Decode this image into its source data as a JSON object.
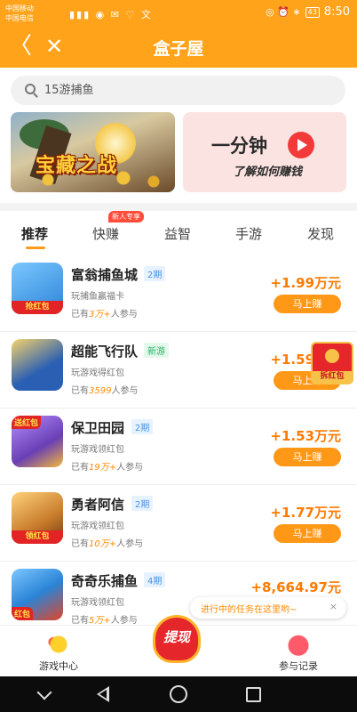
{
  "status_bar": {
    "carrier1": "中国移动",
    "carrier2": "中国电信",
    "icons": "▮▮▮ ◉ ✉ ♡ 文",
    "right_icons": "◎ ⏰ ∗",
    "battery": "43",
    "time": "8:50"
  },
  "nav": {
    "back_icon": "〈",
    "close_icon": "✕",
    "title": "盒子屋"
  },
  "search": {
    "placeholder": "15游捕鱼"
  },
  "banners": {
    "game_title": "宝藏之战",
    "tutorial_line1": "一分钟",
    "tutorial_line2": "了解如何赚钱"
  },
  "tabs": [
    {
      "label": "推荐",
      "active": true
    },
    {
      "label": "快赚",
      "badge": "新人专享"
    },
    {
      "label": "益智"
    },
    {
      "label": "手游"
    },
    {
      "label": "发现"
    }
  ],
  "games": [
    {
      "name": "富翁捕鱼城",
      "tag": "2期",
      "tag_type": "blue",
      "desc": "玩捕鱼赢福卡",
      "count_prefix": "已有",
      "count": "3万+",
      "count_suffix": "人参与",
      "reward": "+1.99万元",
      "button": "马上赚",
      "icon_text": "抢红包",
      "icon_color": "#2a84d6"
    },
    {
      "name": "超能飞行队",
      "tag": "新游",
      "tag_type": "green",
      "desc": "玩游戏得红包",
      "count_prefix": "已有",
      "count": "3599",
      "count_suffix": "人参与",
      "reward": "+1.59万元",
      "button": "马上赚",
      "icon_text": "",
      "icon_color": "#2a5fb3"
    },
    {
      "name": "保卫田园",
      "tag": "2期",
      "tag_type": "blue",
      "desc": "玩游戏领红包",
      "count_prefix": "已有",
      "count": "19万+",
      "count_suffix": "人参与",
      "reward": "+1.53万元",
      "button": "马上赚",
      "icon_text": "送红包",
      "icon_color": "#6a3fb5"
    },
    {
      "name": "勇者阿信",
      "tag": "2期",
      "tag_type": "blue",
      "desc": "玩游戏领红包",
      "count_prefix": "已有",
      "count": "10万+",
      "count_suffix": "人参与",
      "reward": "+1.77万元",
      "button": "马上赚",
      "icon_text": "领红包",
      "icon_color": "#c77a2a"
    },
    {
      "name": "奇奇乐捕鱼",
      "tag": "4期",
      "tag_type": "blue",
      "desc": "玩游戏领红包",
      "count_prefix": "已有",
      "count": "5万+",
      "count_suffix": "人参与",
      "reward": "+8,664.97元",
      "button": "",
      "icon_text": "红包",
      "icon_color": "#2a84d6"
    }
  ],
  "float_redpacket": {
    "label": "拆红包"
  },
  "task_tip": {
    "text": "进行中的任务在这里哟~",
    "close": "×"
  },
  "bottom_bar": {
    "game_center": "游戏中心",
    "withdraw": "提现",
    "records": "参与记录"
  }
}
